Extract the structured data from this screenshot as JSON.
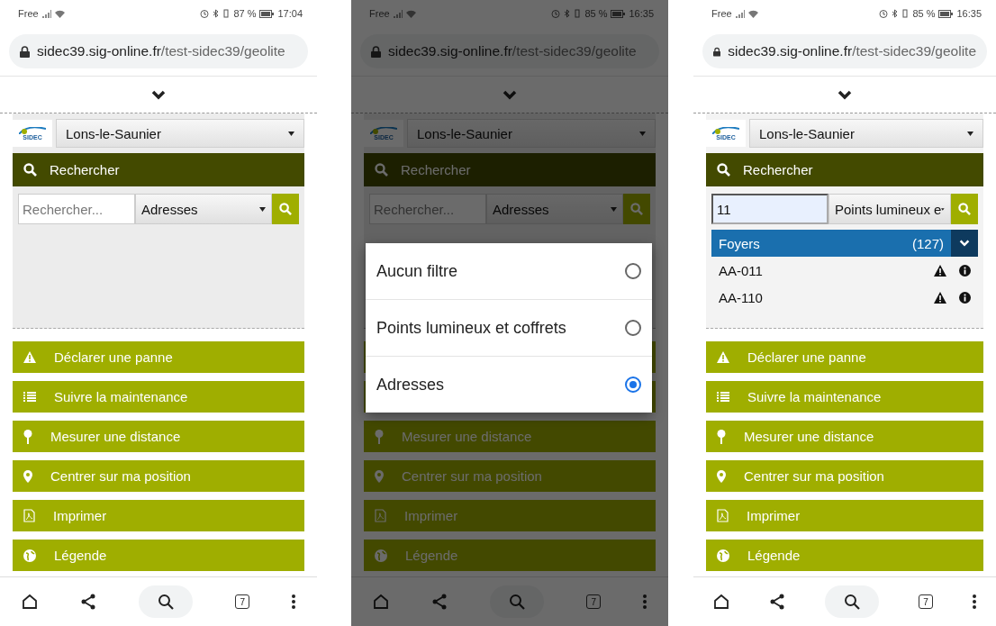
{
  "phones": [
    {
      "status": {
        "carrier": "Free",
        "battery": "87 %",
        "time": "17:04"
      },
      "url": {
        "host": "sidec39.sig-online.fr",
        "path": "/test-sidec39/geolite"
      },
      "logo_text": "SIDEC",
      "place": "Lons-le-Saunier",
      "search_title": "Rechercher",
      "search": {
        "placeholder": "Rechercher..."
      },
      "filter": "Adresses",
      "menu": [
        "Déclarer une panne",
        "Suivre la maintenance",
        "Mesurer une distance",
        "Centrer sur ma position",
        "Imprimer",
        "Légende"
      ],
      "tab_count": "7"
    },
    {
      "status": {
        "carrier": "Free",
        "battery": "85 %",
        "time": "16:35"
      },
      "url": {
        "host": "sidec39.sig-online.fr",
        "path": "/test-sidec39/geolite"
      },
      "logo_text": "SIDEC",
      "place": "Lons-le-Saunier",
      "search_title": "Rechercher",
      "search": {
        "placeholder": "Rechercher..."
      },
      "filter": "Adresses",
      "dimmed": true,
      "dialog": [
        {
          "label": "Aucun filtre",
          "selected": false
        },
        {
          "label": "Points lumineux et coffrets",
          "selected": false
        },
        {
          "label": "Adresses",
          "selected": true
        }
      ],
      "menu": [
        {
          "covered": true
        },
        {
          "covered": true
        },
        "Mesurer une distance",
        "Centrer sur ma position",
        "Imprimer",
        "Légende"
      ],
      "tab_count": "7"
    },
    {
      "status": {
        "carrier": "Free",
        "battery": "85 %",
        "time": "16:35"
      },
      "url": {
        "host": "sidec39.sig-online.fr",
        "path": "/test-sidec39/geolite"
      },
      "logo_text": "SIDEC",
      "place": "Lons-le-Saunier",
      "search_title": "Rechercher",
      "search": {
        "value": "11"
      },
      "filter": "Points lumineux e",
      "results": {
        "group": "Foyers",
        "count": "(127)",
        "rows": [
          "AA-011",
          "AA-110"
        ]
      },
      "menu": [
        "Déclarer une panne",
        "Suivre la maintenance",
        "Mesurer une distance",
        "Centrer sur ma position",
        "Imprimer",
        "Légende"
      ],
      "tab_count": "7"
    }
  ]
}
